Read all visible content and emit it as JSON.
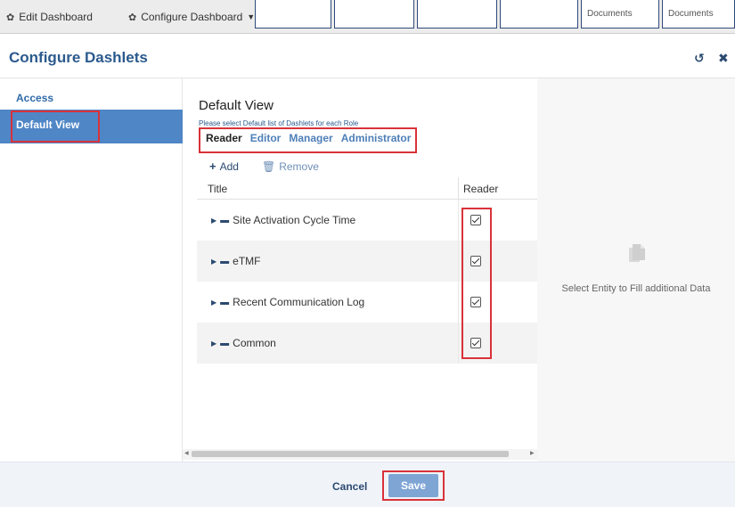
{
  "toolbar": {
    "edit_dashboard": "Edit Dashboard",
    "configure_dashboard": "Configure Dashboard",
    "tiles": [
      "Documents",
      "Documents"
    ]
  },
  "modal": {
    "title": "Configure Dashlets",
    "reset_icon": "reset-icon",
    "close_icon": "close-icon"
  },
  "sidebar": {
    "items": [
      {
        "label": "Access"
      },
      {
        "label": "Default View"
      }
    ]
  },
  "main": {
    "title": "Default View",
    "subtitle": "Please select Default list of Dashlets for each Role",
    "tabs": [
      {
        "label": "Reader"
      },
      {
        "label": "Editor"
      },
      {
        "label": "Manager"
      },
      {
        "label": "Administrator"
      }
    ],
    "add_label": "Add",
    "remove_label": "Remove",
    "columns": {
      "title": "Title",
      "reader": "Reader"
    },
    "rows": [
      {
        "title": "Site Activation Cycle Time",
        "reader": true
      },
      {
        "title": "eTMF",
        "reader": true
      },
      {
        "title": "Recent Communication Log",
        "reader": true
      },
      {
        "title": "Common",
        "reader": true
      }
    ]
  },
  "right_panel": {
    "message": "Select Entity to Fill additional Data"
  },
  "footer": {
    "cancel_label": "Cancel",
    "save_label": "Save"
  },
  "colors": {
    "accent": "#4f86c6",
    "brand_text": "#2b5a8d",
    "highlight": "#d9323a",
    "save_button": "#7fa5d5"
  }
}
